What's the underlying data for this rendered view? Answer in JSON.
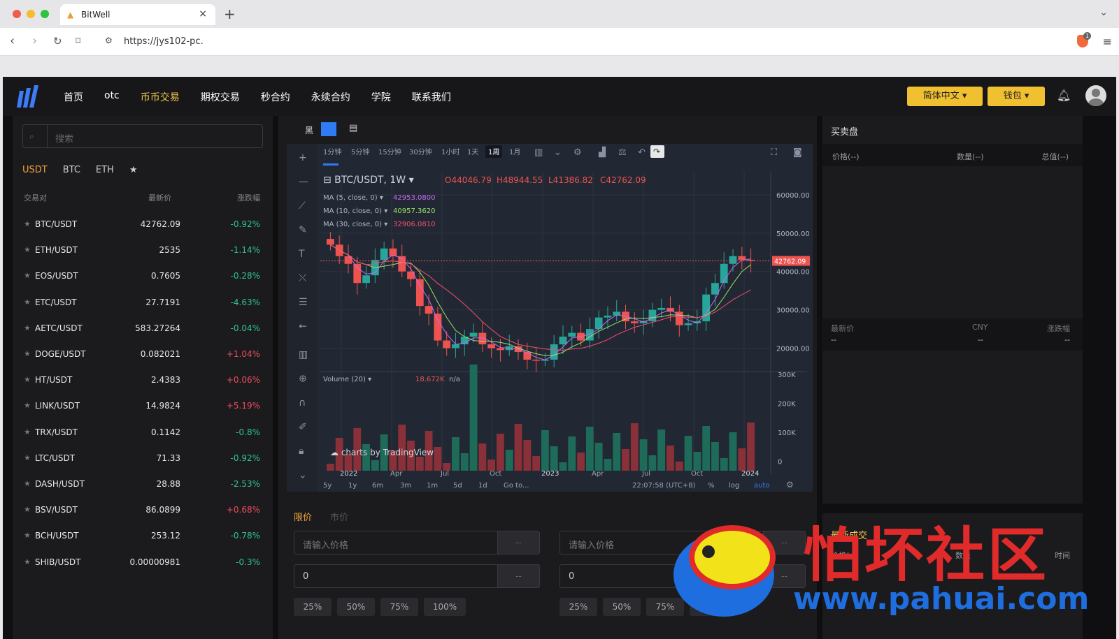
{
  "browser": {
    "tab_title": "BitWell",
    "url": "https://jys102-pc.",
    "shield_badge": "1"
  },
  "nav": {
    "items": [
      "首页",
      "otc",
      "币币交易",
      "期权交易",
      "秒合约",
      "永续合约",
      "学院",
      "联系我们"
    ],
    "active_index": 2,
    "lang_btn": "简体中文",
    "wallet_btn": "钱包"
  },
  "market": {
    "search_placeholder": "搜索",
    "tabs": [
      "USDT",
      "BTC",
      "ETH",
      "★"
    ],
    "active_tab": 0,
    "headers": {
      "pair": "交易对",
      "price": "最新价",
      "change": "涨跌幅"
    },
    "pairs": [
      {
        "sym": "BTC/USDT",
        "price": "42762.09",
        "change": "-0.92%",
        "up": false
      },
      {
        "sym": "ETH/USDT",
        "price": "2535",
        "change": "-1.14%",
        "up": false
      },
      {
        "sym": "EOS/USDT",
        "price": "0.7605",
        "change": "-0.28%",
        "up": false
      },
      {
        "sym": "ETC/USDT",
        "price": "27.7191",
        "change": "-4.63%",
        "up": false
      },
      {
        "sym": "AETC/USDT",
        "price": "583.27264",
        "change": "-0.04%",
        "up": false
      },
      {
        "sym": "DOGE/USDT",
        "price": "0.082021",
        "change": "+1.04%",
        "up": true
      },
      {
        "sym": "HT/USDT",
        "price": "2.4383",
        "change": "+0.06%",
        "up": true
      },
      {
        "sym": "LINK/USDT",
        "price": "14.9824",
        "change": "+5.19%",
        "up": true
      },
      {
        "sym": "TRX/USDT",
        "price": "0.1142",
        "change": "-0.8%",
        "up": false
      },
      {
        "sym": "LTC/USDT",
        "price": "71.33",
        "change": "-0.92%",
        "up": false
      },
      {
        "sym": "DASH/USDT",
        "price": "28.88",
        "change": "-2.53%",
        "up": false
      },
      {
        "sym": "BSV/USDT",
        "price": "86.0899",
        "change": "+0.68%",
        "up": true
      },
      {
        "sym": "BCH/USDT",
        "price": "253.12",
        "change": "-0.78%",
        "up": false
      },
      {
        "sym": "SHIB/USDT",
        "price": "0.00000981",
        "change": "-0.3%",
        "up": false
      }
    ]
  },
  "chart": {
    "theme_label": "黑",
    "intervals": [
      "1分钟",
      "5分钟",
      "15分钟",
      "30分钟",
      "1小时",
      "1天",
      "1周",
      "1月"
    ],
    "active_interval": 6,
    "symbol": "BTC/USDT, 1W",
    "ohlc": {
      "o": "44046.79",
      "h": "48944.55",
      "l": "41386.82",
      "c": "42762.09"
    },
    "ma": [
      {
        "label": "MA (5, close, 0)",
        "value": "42953.0800",
        "color": "#c76cf2"
      },
      {
        "label": "MA (10, close, 0)",
        "value": "40957.3620",
        "color": "#9ae06e"
      },
      {
        "label": "MA (30, close, 0)",
        "value": "32906.0810",
        "color": "#f0506e"
      }
    ],
    "price_axis": [
      "60000.00",
      "50000.00",
      "40000.00",
      "30000.00",
      "20000.00"
    ],
    "last_price": "42762.09",
    "volume_label": "Volume (20)",
    "volume_value": "18.672K",
    "volume_na": "n/a",
    "volume_axis": [
      "300K",
      "200K",
      "100K",
      "0"
    ],
    "time_axis": [
      "2022",
      "Apr",
      "Jul",
      "Oct",
      "2023",
      "Apr",
      "Jul",
      "Oct",
      "2024"
    ],
    "ranges": [
      "5y",
      "1y",
      "6m",
      "3m",
      "1m",
      "5d",
      "1d",
      "Go to..."
    ],
    "clock": "22:07:58 (UTC+8)",
    "scale_opts": [
      "%",
      "log",
      "auto"
    ],
    "watermark": "charts by TradingView",
    "chart_data": {
      "type": "candlestick",
      "title": "BTC/USDT, 1W",
      "ylim": [
        15000,
        66000
      ],
      "close_path": [
        47000,
        44000,
        42000,
        37000,
        39000,
        43000,
        46000,
        44000,
        40000,
        38000,
        31000,
        29000,
        22000,
        20000,
        21000,
        23000,
        24000,
        21000,
        20000,
        19500,
        20500,
        19000,
        17000,
        16800,
        17000,
        21000,
        23000,
        24000,
        22000,
        25000,
        28000,
        28500,
        29500,
        27000,
        26500,
        27000,
        30000,
        30500,
        29500,
        26000,
        26500,
        27000,
        34000,
        37000,
        42000,
        44000,
        43000,
        42762
      ]
    }
  },
  "order": {
    "tabs": [
      "限价",
      "市价"
    ],
    "active_tab": 0,
    "price_placeholder": "请输入价格",
    "amount_value": "0",
    "unit": "--",
    "pcts": [
      "25%",
      "50%",
      "75%",
      "100%"
    ]
  },
  "orderbook": {
    "title": "买卖盘",
    "headers": [
      "价格(--)",
      "数量(--)",
      "总值(--)"
    ],
    "mid_headers": [
      "最新价",
      "CNY",
      "涨跌幅"
    ],
    "mid_values": [
      "--",
      "--",
      "--"
    ],
    "trades_title": "最新成交",
    "trade_headers": [
      "价格(",
      "数量",
      "时间"
    ]
  },
  "watermark": {
    "cn": "怕坏社区",
    "url": "www.pahuai.com"
  }
}
